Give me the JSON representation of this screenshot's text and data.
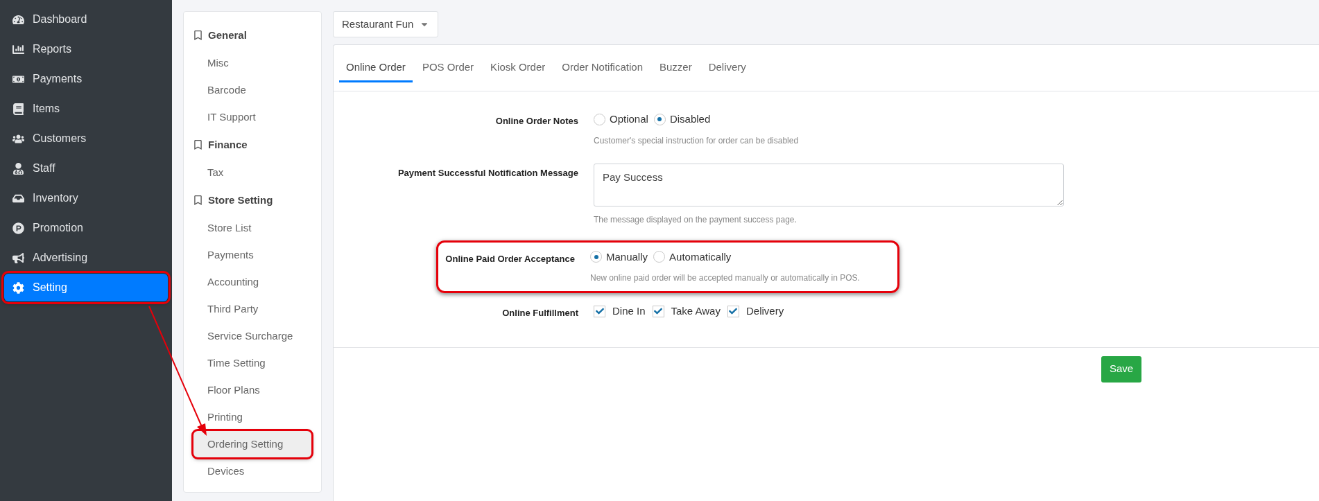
{
  "sidebar": {
    "items": [
      {
        "label": "Dashboard",
        "selected": false,
        "highlighted": false
      },
      {
        "label": "Reports",
        "selected": false,
        "highlighted": false
      },
      {
        "label": "Payments",
        "selected": false,
        "highlighted": false
      },
      {
        "label": "Items",
        "selected": false,
        "highlighted": false
      },
      {
        "label": "Customers",
        "selected": false,
        "highlighted": false
      },
      {
        "label": "Staff",
        "selected": false,
        "highlighted": false
      },
      {
        "label": "Inventory",
        "selected": false,
        "highlighted": false
      },
      {
        "label": "Promotion",
        "selected": false,
        "highlighted": false
      },
      {
        "label": "Advertising",
        "selected": false,
        "highlighted": false
      },
      {
        "label": "Setting",
        "selected": true,
        "highlighted": true
      }
    ]
  },
  "settings_menu": {
    "sections": [
      {
        "title": "General",
        "children": [
          {
            "label": "Misc",
            "selected": false,
            "highlighted": false
          },
          {
            "label": "Barcode",
            "selected": false,
            "highlighted": false
          },
          {
            "label": "IT Support",
            "selected": false,
            "highlighted": false
          }
        ]
      },
      {
        "title": "Finance",
        "children": [
          {
            "label": "Tax",
            "selected": false,
            "highlighted": false
          }
        ]
      },
      {
        "title": "Store Setting",
        "children": [
          {
            "label": "Store List",
            "selected": false,
            "highlighted": false
          },
          {
            "label": "Payments",
            "selected": false,
            "highlighted": false
          },
          {
            "label": "Accounting",
            "selected": false,
            "highlighted": false
          },
          {
            "label": "Third Party",
            "selected": false,
            "highlighted": false
          },
          {
            "label": "Service Surcharge",
            "selected": false,
            "highlighted": false
          },
          {
            "label": "Time Setting",
            "selected": false,
            "highlighted": false
          },
          {
            "label": "Floor Plans",
            "selected": false,
            "highlighted": false
          },
          {
            "label": "Printing",
            "selected": false,
            "highlighted": false
          },
          {
            "label": "Ordering Setting",
            "selected": true,
            "highlighted": true
          },
          {
            "label": "Devices",
            "selected": false,
            "highlighted": false
          }
        ]
      }
    ]
  },
  "store_select": {
    "value": "Restaurant Fun"
  },
  "tabs": [
    {
      "label": "Online Order",
      "selected": true
    },
    {
      "label": "POS Order",
      "selected": false
    },
    {
      "label": "Kiosk Order",
      "selected": false
    },
    {
      "label": "Order Notification",
      "selected": false
    },
    {
      "label": "Buzzer",
      "selected": false
    },
    {
      "label": "Delivery",
      "selected": false
    }
  ],
  "form": {
    "rows": [
      {
        "kind": "radio",
        "label": "Online Order Notes",
        "highlighted": false,
        "options": [
          {
            "label": "Optional",
            "selected": false
          },
          {
            "label": "Disabled",
            "selected": true
          }
        ],
        "hint": "Customer's special instruction for order can be disabled"
      },
      {
        "kind": "textarea",
        "label": "Payment Successful Notification Message",
        "highlighted": false,
        "value": "Pay Success",
        "hint": "The message displayed on the payment success page."
      },
      {
        "kind": "radio",
        "label": "Online Paid Order Acceptance",
        "highlighted": true,
        "options": [
          {
            "label": "Manually",
            "selected": true
          },
          {
            "label": "Automatically",
            "selected": false
          }
        ],
        "hint": "New online paid order will be accepted manually or automatically in POS."
      },
      {
        "kind": "checkbox",
        "label": "Online Fulfillment",
        "highlighted": false,
        "options": [
          {
            "label": "Dine In",
            "checked": true
          },
          {
            "label": "Take Away",
            "checked": true
          },
          {
            "label": "Delivery",
            "checked": true
          }
        ]
      }
    ],
    "save_button": "Save"
  }
}
